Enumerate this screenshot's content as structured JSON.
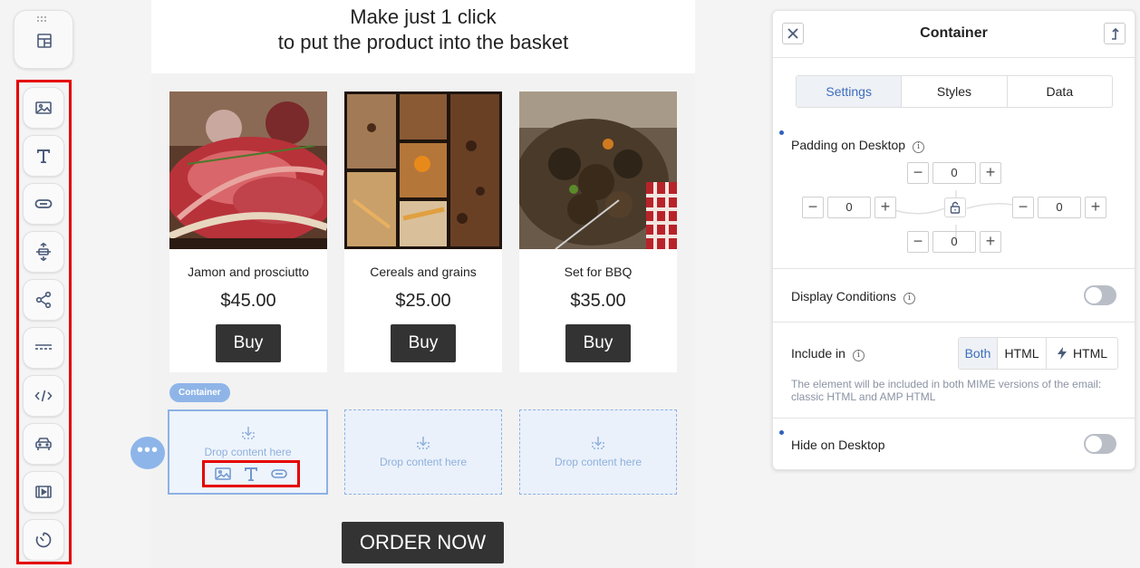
{
  "toolbar": {
    "tools": [
      {
        "name": "image-block",
        "icon": "image-icon"
      },
      {
        "name": "text-block",
        "icon": "text-icon"
      },
      {
        "name": "button-block",
        "icon": "button-icon"
      },
      {
        "name": "spacer-block",
        "icon": "spacer-icon"
      },
      {
        "name": "social-block",
        "icon": "share-icon"
      },
      {
        "name": "divider-block",
        "icon": "divider-icon"
      },
      {
        "name": "html-block",
        "icon": "code-icon"
      },
      {
        "name": "menu-block",
        "icon": "car-icon"
      },
      {
        "name": "video-block",
        "icon": "video-icon"
      },
      {
        "name": "timer-block",
        "icon": "timer-icon"
      }
    ]
  },
  "email": {
    "headline_line1": "Make just 1 click",
    "headline_line2": "to put the product into the basket",
    "products": [
      {
        "name": "Jamon and prosciutto",
        "price": "$45.00",
        "button": "Buy"
      },
      {
        "name": "Cereals and grains",
        "price": "$25.00",
        "button": "Buy"
      },
      {
        "name": "Set for BBQ",
        "price": "$35.00",
        "button": "Buy"
      }
    ],
    "container_tag": "Container",
    "drop_text": "Drop content here",
    "order_button": "ORDER NOW",
    "more_glyph": "•••"
  },
  "panel": {
    "title": "Container",
    "tabs": [
      "Settings",
      "Styles",
      "Data"
    ],
    "active_tab": "Settings",
    "padding_label": "Padding on Desktop",
    "padding": {
      "top": "0",
      "left": "0",
      "right": "0",
      "bottom": "0"
    },
    "display_conditions_label": "Display Conditions",
    "include_label": "Include in",
    "include_options": [
      "Both",
      "HTML",
      "HTML"
    ],
    "include_selected": "Both",
    "include_hint": "The element will be included in both MIME versions of the email: classic HTML and AMP HTML",
    "hide_label": "Hide on Desktop",
    "display_conditions_on": false,
    "hide_on_desktop": false
  },
  "colors": {
    "accent": "#3d6ebd",
    "highlight_red": "#e50000",
    "button_dark": "#333333",
    "drop_zone_blue": "#8db1e3"
  }
}
